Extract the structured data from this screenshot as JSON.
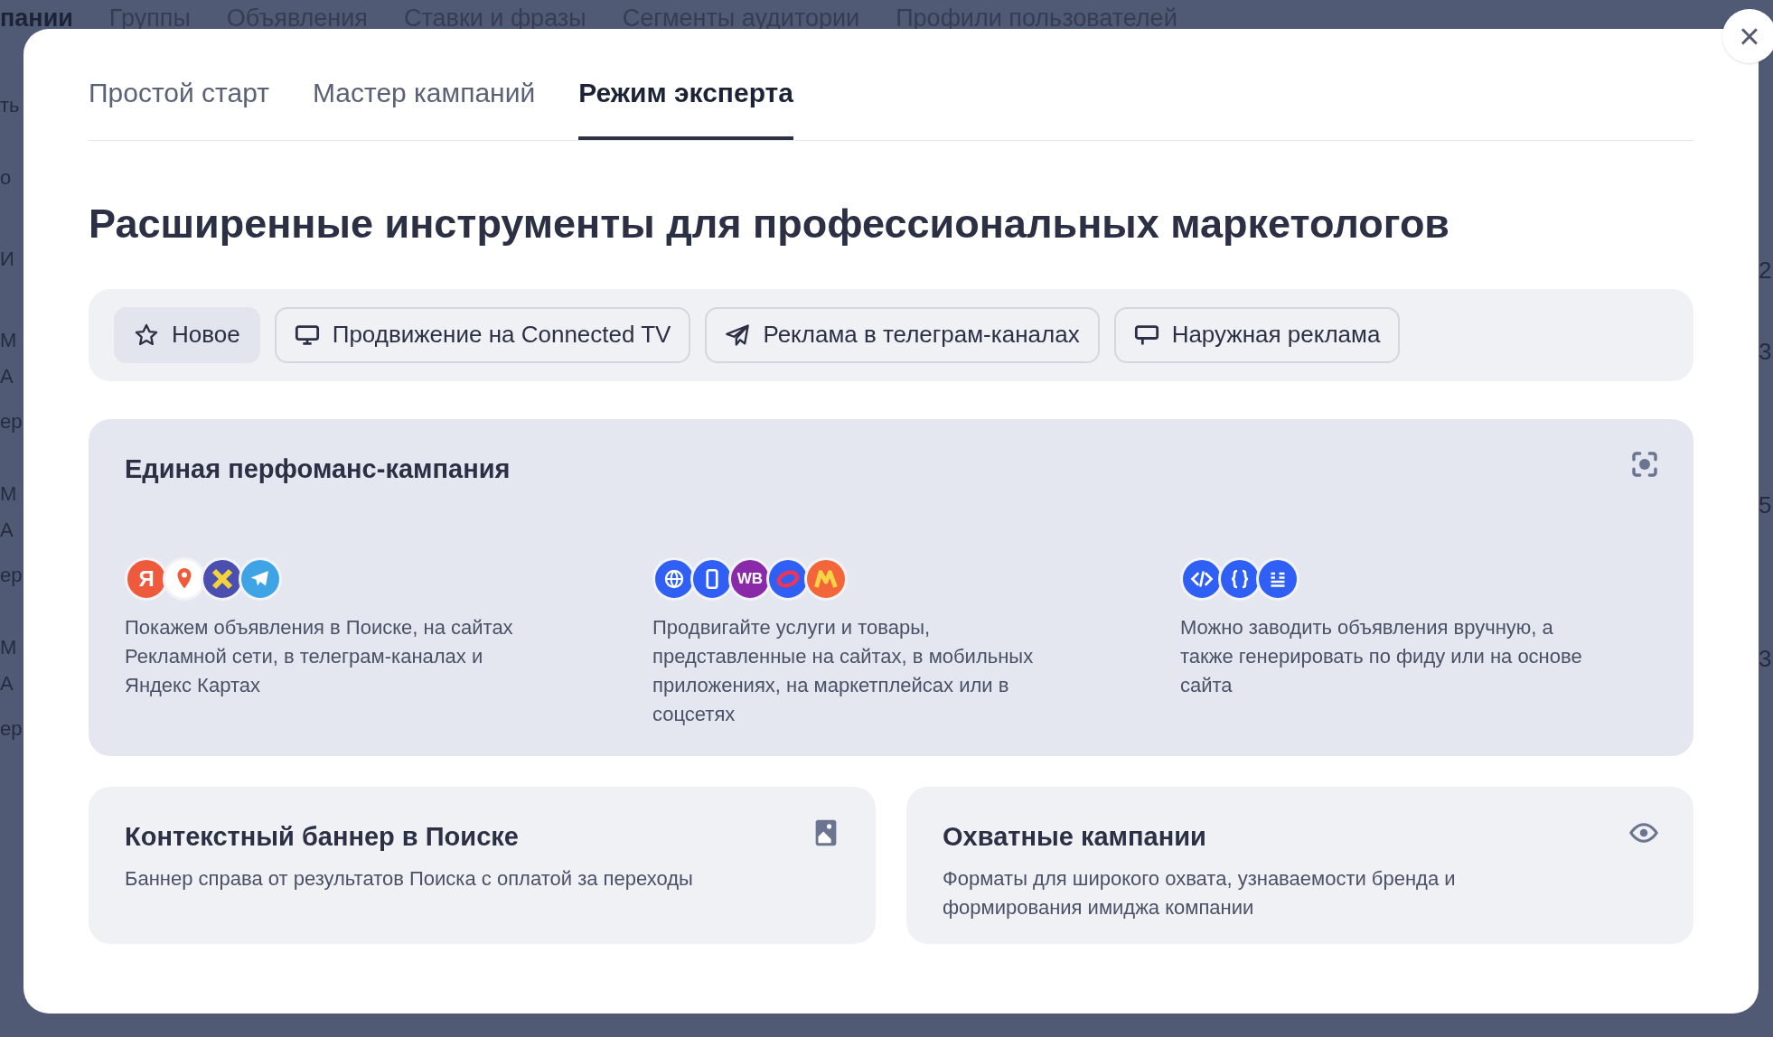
{
  "background_page": {
    "nav_tabs": [
      "пании",
      "Группы",
      "Объявления",
      "Ставки и фразы",
      "Сегменты аудитории",
      "Профили пользователей"
    ],
    "left_fragments": [
      "ть",
      "о",
      "И",
      "М",
      "А",
      "ер",
      "М",
      "А",
      "ер",
      "М",
      "А",
      "ер"
    ],
    "right_fragments": [
      "2",
      "3",
      "5",
      "3"
    ]
  },
  "close_button": {
    "label": "×"
  },
  "tabs": [
    {
      "label": "Простой старт",
      "selected": false
    },
    {
      "label": "Мастер кампаний",
      "selected": false
    },
    {
      "label": "Режим эксперта",
      "selected": true
    }
  ],
  "heading": "Расширенные инструменты для профессиональных маркетологов",
  "chips": [
    {
      "label": "Новое",
      "kind": "star",
      "selected": true
    },
    {
      "label": "Продвижение на Connected TV",
      "kind": "monitor",
      "selected": false
    },
    {
      "label": "Реклама в телеграм-каналах",
      "kind": "plane",
      "selected": false
    },
    {
      "label": "Наружная реклама",
      "kind": "billboard",
      "selected": false
    }
  ],
  "main_card": {
    "title": "Единая перфоманс-кампания",
    "columns": [
      {
        "logos": [
          {
            "kind": "letter",
            "label": "Я",
            "color": "#ef5a3c"
          },
          {
            "kind": "pin",
            "color": "#ffffff"
          },
          {
            "kind": "cross",
            "color": "#4a4fb0"
          },
          {
            "kind": "plane",
            "color": "#3fa4e6"
          }
        ],
        "text": "Покажем объявления в Поиске, на сайтах Рекламной сети, в телеграм-каналах и Яндекс Картах"
      },
      {
        "logos": [
          {
            "kind": "globe",
            "color": "#2f5ff5"
          },
          {
            "kind": "phone",
            "color": "#2f5ff5"
          },
          {
            "kind": "letter",
            "label": "WB",
            "color": "#8a2aa8"
          },
          {
            "kind": "ring",
            "color": "#2f5ff5"
          },
          {
            "kind": "m",
            "color": "#f2663a"
          }
        ],
        "text": "Продвигайте услуги и товары, представленные на сайтах, в мобильных приложениях, на маркетплейсах или в соцсетях"
      },
      {
        "logos": [
          {
            "kind": "code",
            "color": "#2f5ff5"
          },
          {
            "kind": "braces",
            "color": "#2f5ff5"
          },
          {
            "kind": "list",
            "color": "#2f5ff5"
          }
        ],
        "text": "Можно заводить объявления вручную, а также генерировать по фиду или на основе сайта"
      }
    ]
  },
  "cards": [
    {
      "title": "Контекстный баннер в Поиске",
      "kind": "image",
      "text": "Баннер справа от результатов Поиска с оплатой за переходы"
    },
    {
      "title": "Охватные кампании",
      "kind": "eye",
      "text": "Форматы для широкого охвата, узнаваемости бренда и формирования имиджа компании"
    }
  ]
}
